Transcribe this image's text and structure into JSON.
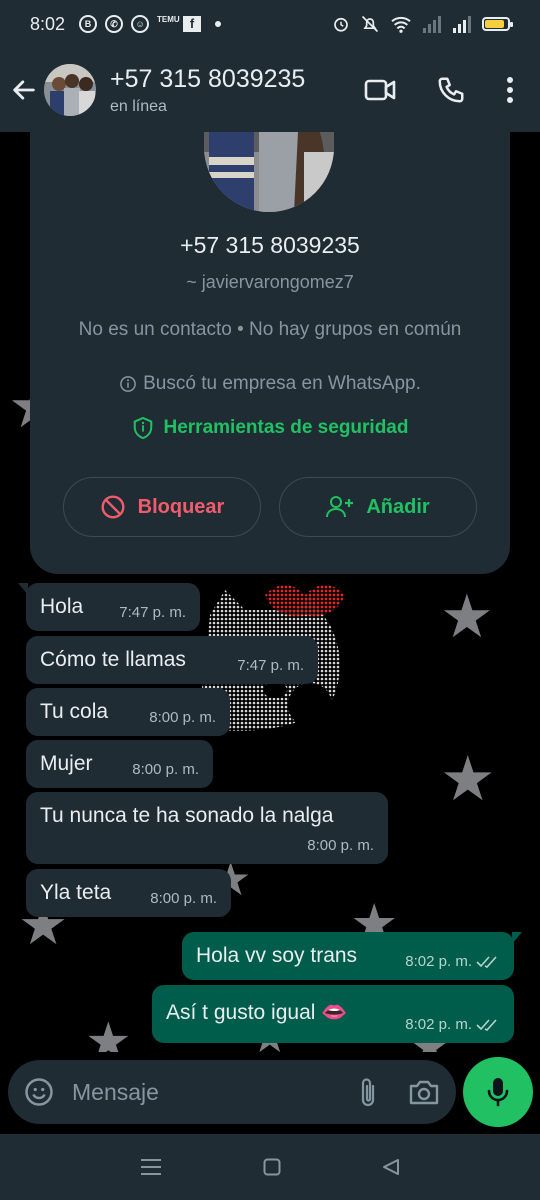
{
  "status_bar": {
    "time": "8:02",
    "app_badges": [
      "B",
      "TEMU",
      "f"
    ],
    "battery_level": 0.85,
    "battery_color": "#f4d03f"
  },
  "header": {
    "title": "+57 315 8039235",
    "subtitle": "en línea"
  },
  "profile_card": {
    "name": "+57 315 8039235",
    "username": "~ javiervarongomez7",
    "info_line1": "No es un contacto • No hay grupos en común",
    "info_line2": "Buscó tu empresa en WhatsApp.",
    "security_label": "Herramientas de seguridad",
    "block_label": "Bloquear",
    "add_label": "Añadir"
  },
  "messages": [
    {
      "direction": "in",
      "text": "Hola",
      "time": "7:47 p. m."
    },
    {
      "direction": "in",
      "text": "Cómo te llamas",
      "time": "7:47 p. m."
    },
    {
      "direction": "in",
      "text": "Tu cola",
      "time": "8:00 p. m."
    },
    {
      "direction": "in",
      "text": "Mujer",
      "time": "8:00 p. m."
    },
    {
      "direction": "in",
      "text": "Tu nunca te ha sonado la nalga",
      "time": "8:00 p. m."
    },
    {
      "direction": "in",
      "text": "Yla teta",
      "time": "8:00 p. m."
    },
    {
      "direction": "out",
      "text": "Hola vv soy trans",
      "time": "8:02 p. m.",
      "read": true
    },
    {
      "direction": "out",
      "text": "Así t gusto igual 👄",
      "time": "8:02 p. m.",
      "read": true
    }
  ],
  "composer": {
    "placeholder": "Mensaje"
  },
  "colors": {
    "header_bg": "#1f2c34",
    "incoming_bubble": "#1f2c34",
    "outgoing_bubble": "#005c4b",
    "accent_green": "#21c063",
    "danger_red": "#f15c6d"
  }
}
